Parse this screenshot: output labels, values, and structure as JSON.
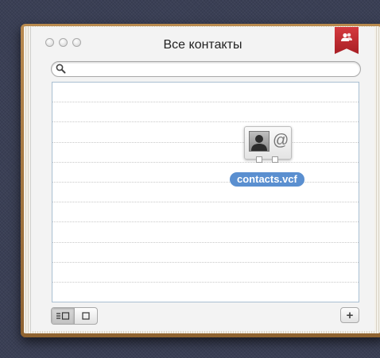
{
  "window": {
    "title": "Все контакты",
    "controls": [
      "close",
      "minimize",
      "zoom"
    ]
  },
  "bookmark_icon": "group-contacts-icon",
  "search": {
    "value": "",
    "placeholder": "",
    "icon": "search-icon"
  },
  "contact_list": {
    "row_count": 11
  },
  "drag_item": {
    "filename": "contacts.vcf",
    "icon": "vcard-icon"
  },
  "footer": {
    "view_buttons": [
      {
        "icon": "list-view-icon",
        "selected": true
      },
      {
        "icon": "card-view-icon",
        "selected": false
      }
    ],
    "add_icon": "plus-icon",
    "add_label": "+"
  },
  "colors": {
    "selection": "#5a8fd0",
    "ribbon": "#c32a30",
    "leather": "#a87a40"
  }
}
